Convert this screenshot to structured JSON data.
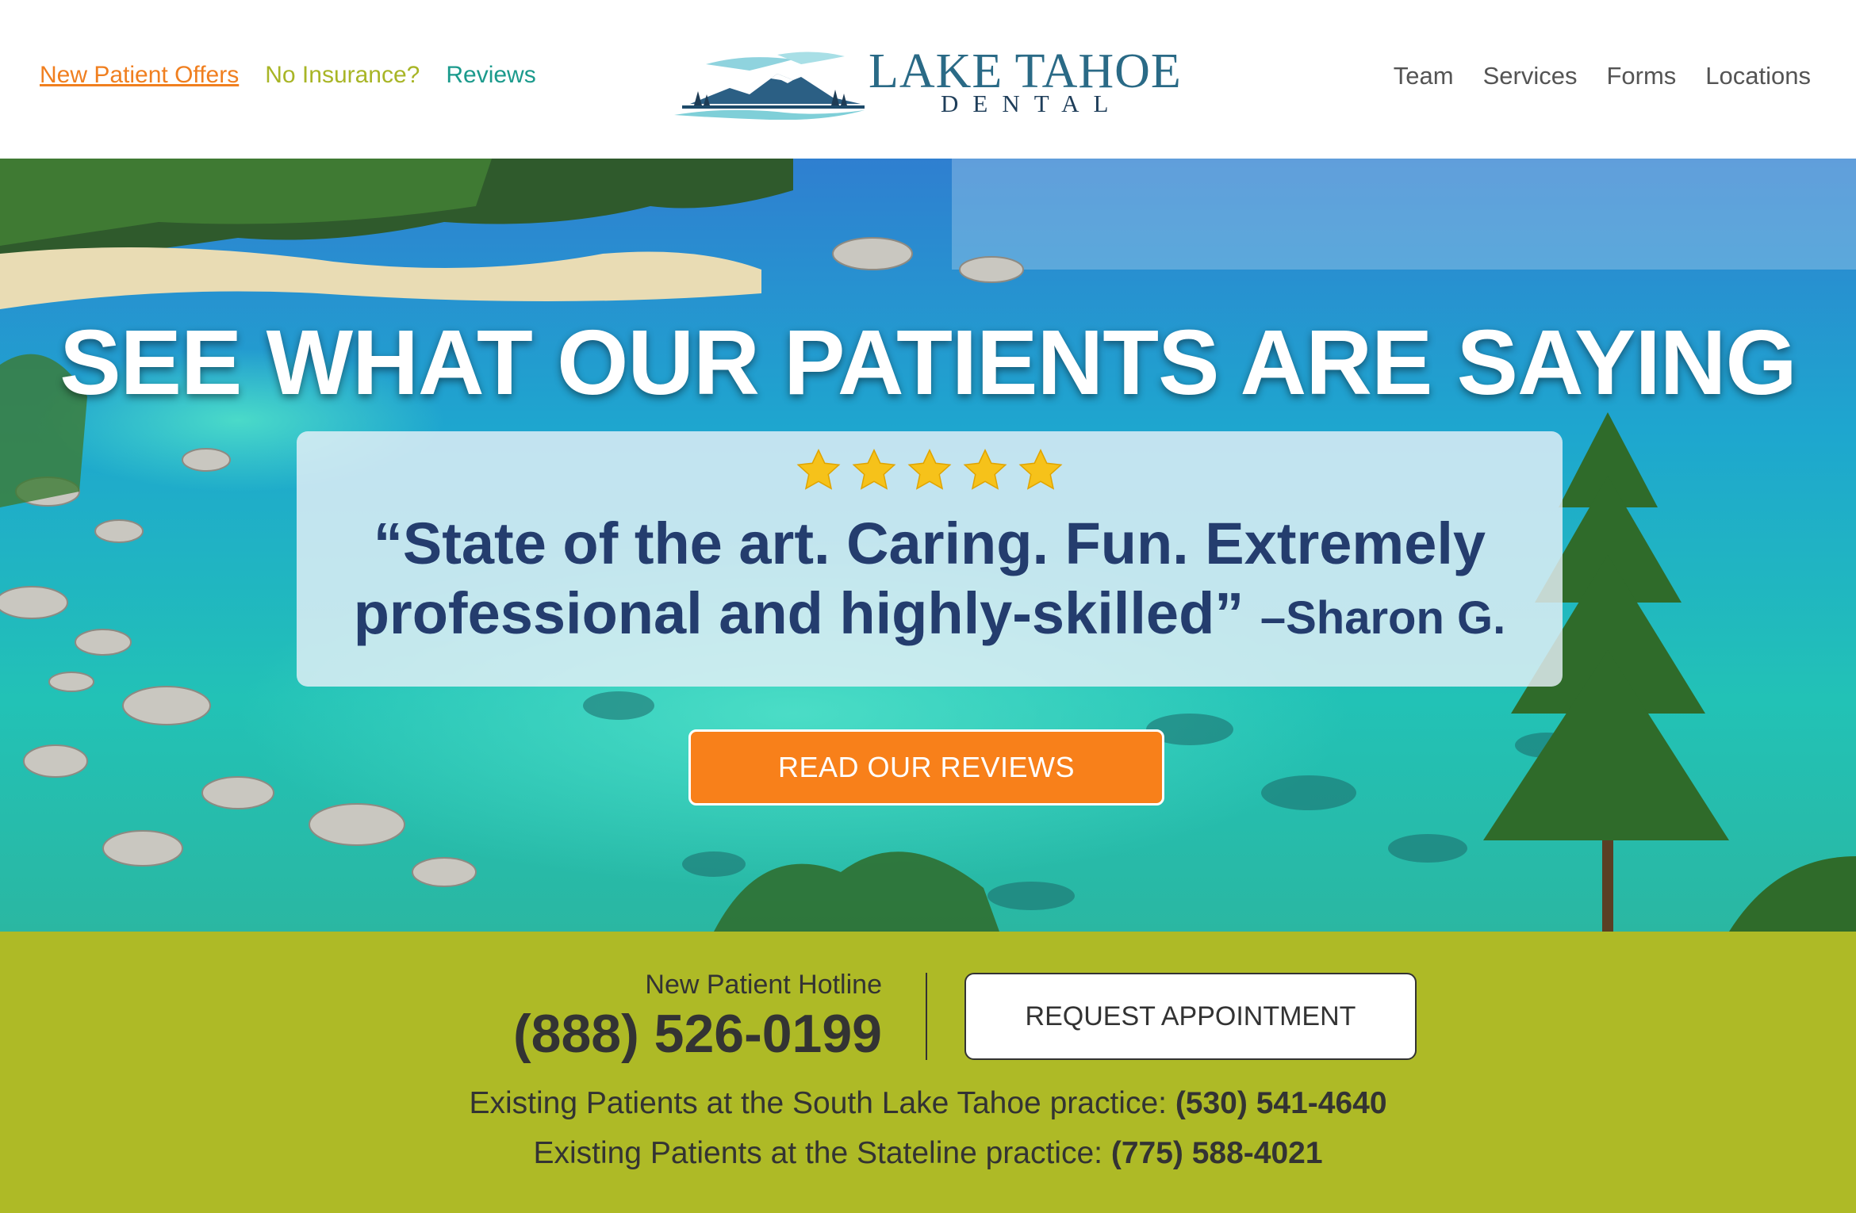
{
  "header": {
    "left_nav": [
      "New Patient Offers",
      "No Insurance?",
      "Reviews"
    ],
    "logo": {
      "title": "LAKE TAHOE",
      "subtitle": "DENTAL"
    },
    "right_nav": [
      "Team",
      "Services",
      "Forms",
      "Locations"
    ]
  },
  "hero": {
    "title": "SEE WHAT OUR PATIENTS ARE SAYING",
    "rating_stars": 5,
    "quote_line1": "“State of the art. Caring. Fun. Extremely",
    "quote_line2": "professional and highly-skilled”",
    "quote_author": "–Sharon G.",
    "cta": "READ OUR REVIEWS"
  },
  "contact": {
    "hotline_label": "New Patient Hotline",
    "hotline_phone": "(888) 526-0199",
    "appointment_button": "REQUEST APPOINTMENT",
    "existing_south_text": "Existing Patients at the South Lake Tahoe practice:",
    "existing_south_phone": "(530) 541-4640",
    "existing_stateline_text": "Existing Patients at the Stateline practice:",
    "existing_stateline_phone": "(775) 588-4021"
  },
  "colors": {
    "accent_orange": "#f8801a",
    "accent_green": "#aeba26",
    "teal": "#1b9a8c",
    "navy": "#243d6e",
    "star": "#f6c21a"
  },
  "icons": [
    "star-icon",
    "logo-mountain-icon"
  ]
}
